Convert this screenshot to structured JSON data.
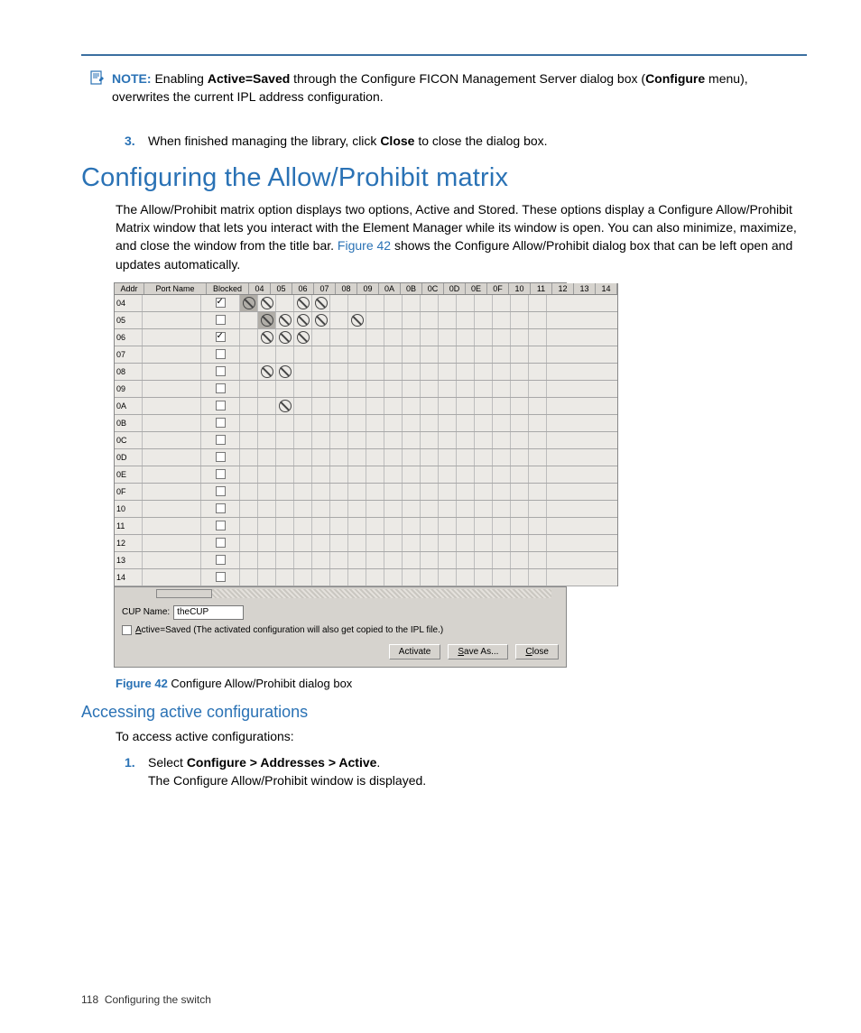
{
  "note": {
    "label": "NOTE:",
    "text_before": "Enabling ",
    "bold1": "Active=Saved",
    "text_mid": " through the Configure FICON Management Server dialog box (",
    "bold2": "Configure",
    "text_after": " menu), overwrites the current IPL address configuration."
  },
  "step3": {
    "num": "3.",
    "pre": "When finished managing the library, click ",
    "bold": "Close",
    "post": " to close the dialog box."
  },
  "heading1": "Configuring the Allow/Prohibit matrix",
  "para1_pre": "The Allow/Prohibit matrix option displays two options, Active and Stored. These options display a Configure Allow/Prohibit Matrix window that lets you interact with the Element Manager while its window is open. You can also minimize, maximize, and close the window from the title bar. ",
  "para1_link": "Figure 42",
  "para1_post": " shows the Configure Allow/Prohibit dialog box that can be left open and updates automatically.",
  "screenshot": {
    "headers": {
      "addr": "Addr",
      "port_name": "Port Name",
      "blocked": "Blocked"
    },
    "cols": [
      "04",
      "05",
      "06",
      "07",
      "08",
      "09",
      "0A",
      "0B",
      "0C",
      "0D",
      "0E",
      "0F",
      "10",
      "11",
      "12",
      "13",
      "14"
    ],
    "rows": [
      {
        "addr": "04",
        "blocked": true,
        "cells": {
          "04": "diag",
          "05": "p",
          "07": "p",
          "08": "p"
        }
      },
      {
        "addr": "05",
        "blocked": false,
        "cells": {
          "05": "diag",
          "06": "p",
          "07": "p",
          "08": "p",
          "0A": "p"
        }
      },
      {
        "addr": "06",
        "blocked": true,
        "cells": {
          "05": "p",
          "06": "p",
          "07": "p"
        }
      },
      {
        "addr": "07",
        "blocked": false,
        "cells": {}
      },
      {
        "addr": "08",
        "blocked": false,
        "cells": {
          "05": "p",
          "06": "p"
        }
      },
      {
        "addr": "09",
        "blocked": false,
        "cells": {}
      },
      {
        "addr": "0A",
        "blocked": false,
        "cells": {
          "06": "p"
        }
      },
      {
        "addr": "0B",
        "blocked": false,
        "cells": {}
      },
      {
        "addr": "0C",
        "blocked": false,
        "cells": {}
      },
      {
        "addr": "0D",
        "blocked": false,
        "cells": {}
      },
      {
        "addr": "0E",
        "blocked": false,
        "cells": {}
      },
      {
        "addr": "0F",
        "blocked": false,
        "cells": {}
      },
      {
        "addr": "10",
        "blocked": false,
        "cells": {}
      },
      {
        "addr": "11",
        "blocked": false,
        "cells": {}
      },
      {
        "addr": "12",
        "blocked": false,
        "cells": {}
      },
      {
        "addr": "13",
        "blocked": false,
        "cells": {}
      },
      {
        "addr": "14",
        "blocked": false,
        "cells": {}
      }
    ],
    "cup_label": "CUP Name:",
    "cup_value": "theCUP",
    "active_saved_label": "Active=Saved   (The activated configuration will also get copied to the IPL file.)",
    "active_saved_underline": "A",
    "buttons": {
      "activate": "Activate",
      "saveas": "Save As...",
      "close": "Close"
    }
  },
  "figcaption": {
    "label": "Figure 42",
    "text": " Configure Allow/Prohibit dialog box"
  },
  "heading2": "Accessing active configurations",
  "para2": "To access active configurations:",
  "step1": {
    "num": "1.",
    "pre": "Select ",
    "bold": "Configure > Addresses > Active",
    "post1": ".",
    "line2": "The Configure Allow/Prohibit window is displayed."
  },
  "footer": {
    "pagenum": "118",
    "section": "Configuring the switch"
  }
}
